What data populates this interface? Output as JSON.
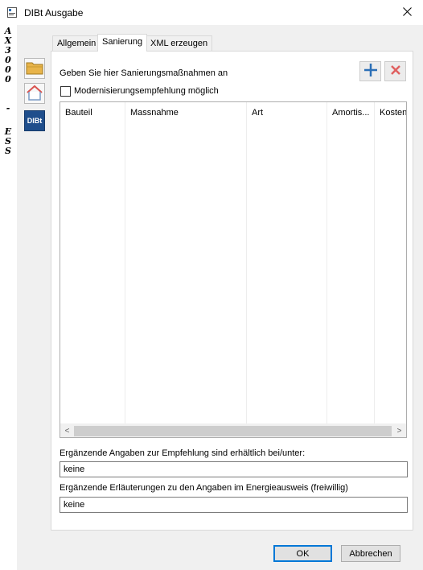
{
  "window": {
    "title": "DIBt Ausgabe",
    "close_glyph": "✕"
  },
  "vertical_label": [
    "A",
    "X",
    "3",
    "0",
    "0",
    "0",
    "-",
    "E",
    "S",
    "S"
  ],
  "sidebar": {
    "items": [
      {
        "icon": "folder-icon"
      },
      {
        "icon": "house-icon"
      },
      {
        "icon": "dibt-icon",
        "text": "DIBt"
      }
    ]
  },
  "tabs": [
    {
      "label": "Allgemein",
      "active": false
    },
    {
      "label": "Sanierung",
      "active": true
    },
    {
      "label": "XML erzeugen",
      "active": false
    }
  ],
  "sanierung": {
    "instruction": "Geben Sie hier Sanierungsmaßnahmen an",
    "checkbox_label": "Modernisierungsempfehlung möglich",
    "checkbox_checked": false,
    "add_glyph": "+",
    "remove_glyph": "✕",
    "table": {
      "columns": [
        "Bauteil",
        "Massnahme",
        "Art",
        "Amortis...",
        "Kosten"
      ],
      "rows": []
    },
    "scroll_left": "<",
    "scroll_right": ">",
    "field1": {
      "label": "Ergänzende Angaben zur Empfehlung sind erhältlich bei/unter:",
      "value": "keine"
    },
    "field2": {
      "label": "Ergänzende Erläuterungen zu den Angaben im Energieausweis (freiwillig)",
      "value": "keine"
    }
  },
  "buttons": {
    "ok": "OK",
    "cancel": "Abbrechen"
  },
  "colors": {
    "accent": "#0078d7",
    "add": "#2b6fb6",
    "remove": "#e06060",
    "folder": "#e8b44a",
    "house": "#d9534f",
    "dibt": "#1f4e8c"
  }
}
